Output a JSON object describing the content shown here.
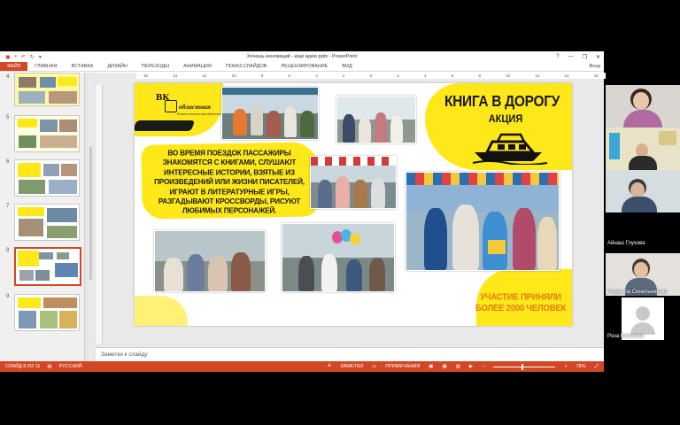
{
  "window": {
    "title": "Хочешь инноваций - ищи идею.pptx - PowerPoint",
    "controls": [
      "?",
      "—",
      "❐",
      "✕"
    ]
  },
  "ribbon": {
    "tabs": [
      "ФАЙЛ",
      "ГЛАВНАЯ",
      "ВСТАВКА",
      "ДИЗАЙН",
      "ПЕРЕХОДЫ",
      "АНИМАЦИЯ",
      "ПОКАЗ СЛАЙДОВ",
      "РЕЦЕНЗИРОВАНИЕ",
      "ВИД"
    ],
    "user": "Вход"
  },
  "thumbnails": {
    "numbers": [
      "4",
      "5",
      "6",
      "7",
      "8",
      "9"
    ],
    "active": "8"
  },
  "ruler": {
    "marks": [
      "16",
      "14",
      "12",
      "10",
      "8",
      "6",
      "4",
      "2",
      "0",
      "2",
      "4",
      "6",
      "8",
      "10",
      "12",
      "14",
      "16"
    ]
  },
  "slide": {
    "logo_vk": "ВК",
    "logo_line1": "областная",
    "logo_line2": "детско-юношеская библиотека",
    "title": "КНИГА В ДОРОГУ",
    "subtitle": "АКЦИЯ",
    "body": "ВО ВРЕМЯ ПОЕЗДОК ПАССАЖИРЫ ЗНАКОМЯТСЯ С КНИГАМИ, СЛУШАЮТ ИНТЕРЕСНЫЕ ИСТОРИИ, ВЗЯТЫЕ ИЗ ПРОИЗВЕДЕНИЙ ИЛИ ЖИЗНИ ПИСАТЕЛЕЙ, ИГРАЮТ В ЛИТЕРАТУРНЫЕ ИГРЫ, РАЗГАДЫВАЮТ КРОССВОРДЫ, РИСУЮТ ЛЮБИМЫХ ПЕРСОНАЖЕЙ.",
    "footer_line1": "УЧАСТИЕ ПРИНЯЛИ",
    "footer_line2": "БОЛЕЕ 2000 ЧЕЛОВЕК"
  },
  "notes": {
    "placeholder": "Заметки к слайду"
  },
  "status": {
    "slide_info": "СЛАЙД 8 ИЗ 11",
    "language": "РУССКИЙ",
    "notes": "ЗАМЕТКИ",
    "comments": "ПРИМЕЧАНИЯ",
    "zoom": "78%"
  },
  "participants": [
    {
      "name": ""
    },
    {
      "name": ""
    },
    {
      "name": ""
    },
    {
      "name": "Айнаш Глухова"
    },
    {
      "name": "Людмила Синельникова"
    },
    {
      "name": "Роза Бакьяева"
    }
  ],
  "colors": {
    "accent": "#d24726",
    "slide_yellow": "#ffe81a",
    "footer_orange": "#e07a0f"
  }
}
